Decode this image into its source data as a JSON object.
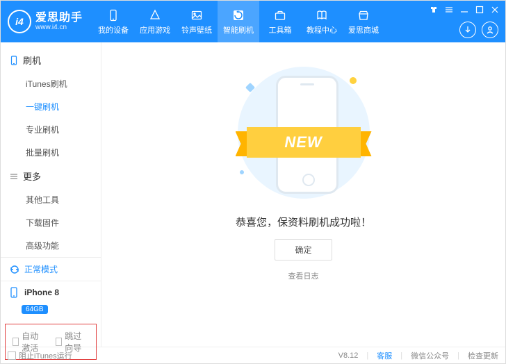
{
  "app": {
    "name": "爱思助手",
    "url": "www.i4.cn",
    "logo_mark": "i4"
  },
  "nav": [
    {
      "label": "我的设备"
    },
    {
      "label": "应用游戏"
    },
    {
      "label": "铃声壁纸"
    },
    {
      "label": "智能刷机"
    },
    {
      "label": "工具箱"
    },
    {
      "label": "教程中心"
    },
    {
      "label": "爱思商城"
    }
  ],
  "sidebar": {
    "groups": [
      {
        "title": "刷机",
        "icon": "phone-icon",
        "items": [
          {
            "label": "iTunes刷机"
          },
          {
            "label": "一键刷机",
            "active": true
          },
          {
            "label": "专业刷机"
          },
          {
            "label": "批量刷机"
          }
        ]
      },
      {
        "title": "更多",
        "icon": "menu-icon",
        "items": [
          {
            "label": "其他工具"
          },
          {
            "label": "下载固件"
          },
          {
            "label": "高级功能"
          }
        ]
      }
    ],
    "mode": {
      "label": "正常模式"
    },
    "device": {
      "name": "iPhone 8",
      "storage": "64GB"
    },
    "checkboxes": {
      "auto_activate": "自动激活",
      "skip_guide": "跳过向导"
    }
  },
  "main": {
    "ribbon": "NEW",
    "success": "恭喜您，保资料刷机成功啦！",
    "ok": "确定",
    "view_log": "查看日志"
  },
  "footer": {
    "block_itunes": "阻止iTunes运行",
    "version": "V8.12",
    "support": "客服",
    "wechat": "微信公众号",
    "update": "检查更新"
  }
}
